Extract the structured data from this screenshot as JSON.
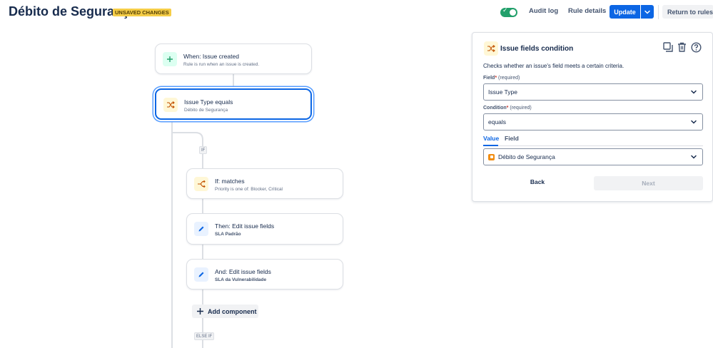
{
  "header": {
    "title": "Débito de Segurança",
    "badge": "UNSAVED CHANGES",
    "toggle_state": "on",
    "audit_log": "Audit log",
    "rule_details": "Rule details",
    "update": "Update",
    "return": "Return to rules"
  },
  "flow": {
    "trigger": {
      "title": "When: Issue created",
      "subtitle": "Rule is run when an issue is created.",
      "icon": "plus-icon"
    },
    "condition": {
      "title": "Issue Type equals",
      "subtitle": "Débito de Segurança",
      "icon": "shuffle-icon"
    },
    "if_tag": "IF",
    "if_block": {
      "title": "If: matches",
      "subtitle": "Priority is one of: Blocker, Critical",
      "icon": "branch-icon"
    },
    "then_block": {
      "title": "Then: Edit issue fields",
      "subtitle": "SLA Padrão",
      "icon": "pencil-icon"
    },
    "and_block": {
      "title": "And: Edit issue fields",
      "subtitle": "SLA da Vulnerabilidade",
      "icon": "pencil-icon"
    },
    "add_component": "Add component",
    "else_if_tag": "ELSE IF"
  },
  "panel": {
    "title": "Issue fields condition",
    "description": "Checks whether an issue's field meets a certain criteria.",
    "field_label": "Field",
    "field_star": "*",
    "field_req": "(required)",
    "field_value": "Issue Type",
    "condition_label": "Condition",
    "condition_star": "*",
    "condition_req": "(required)",
    "condition_value": "equals",
    "tabs": [
      "Value",
      "Field"
    ],
    "value_selected": "Débito de Segurança",
    "back": "Back",
    "next": "Next"
  },
  "colors": {
    "primary": "#0c66e4",
    "toggle_on": "#22a06b",
    "badge_bg": "#f5cd47"
  }
}
